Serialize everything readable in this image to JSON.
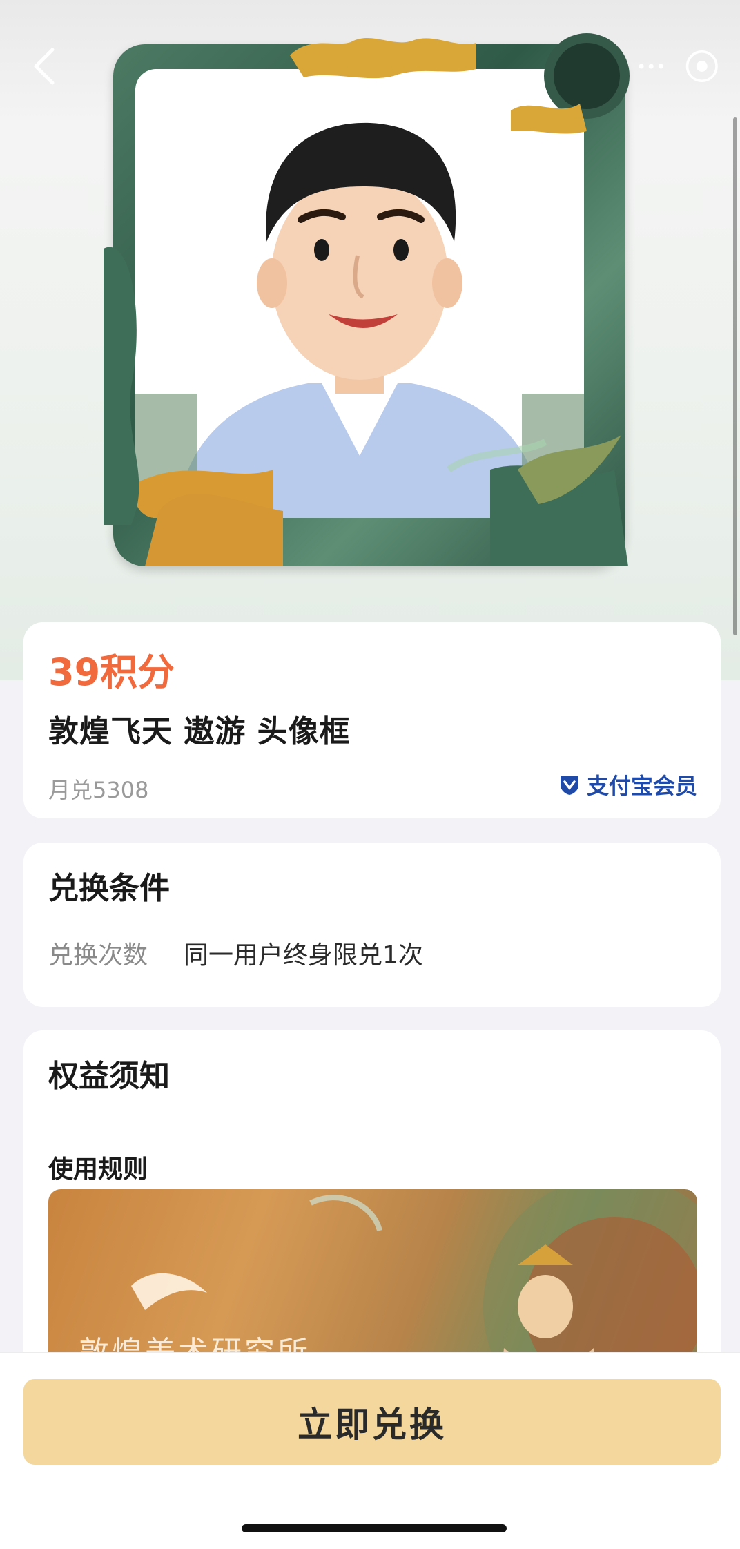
{
  "product": {
    "price": "39积分",
    "title": "敦煌飞天 遨游 头像框",
    "monthly_redemptions": "月兑5308",
    "member_badge": "支付宝会员"
  },
  "conditions": {
    "title": "兑换条件",
    "label": "兑换次数",
    "value": "同一用户终身限兑1次"
  },
  "notice": {
    "title": "权益须知",
    "rules_label": "使用规则",
    "banner_text": "敦煌美术研究所"
  },
  "cta": {
    "label": "立即兑换"
  },
  "icons": {
    "back": "chevron-left-icon",
    "more": "more-dots-icon",
    "target": "target-icon",
    "member": "alipay-member-icon"
  },
  "colors": {
    "price": "#f06a3e",
    "cta_bg": "#f3d79c",
    "member": "#1f4aa8"
  }
}
